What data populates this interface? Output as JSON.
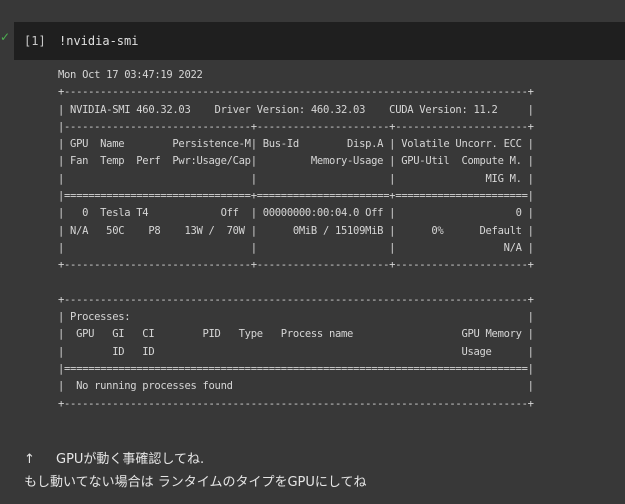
{
  "cell": {
    "execution_count": "[1]",
    "code": "!nvidia-smi",
    "status_icon": "check-icon",
    "status_color": "#4caf50",
    "output_lines": [
      "Mon Oct 17 03:47:19 2022",
      "+-----------------------------------------------------------------------------+",
      "| NVIDIA-SMI 460.32.03    Driver Version: 460.32.03    CUDA Version: 11.2     |",
      "|-------------------------------+----------------------+----------------------+",
      "| GPU  Name        Persistence-M| Bus-Id        Disp.A | Volatile Uncorr. ECC |",
      "| Fan  Temp  Perf  Pwr:Usage/Cap|         Memory-Usage | GPU-Util  Compute M. |",
      "|                               |                      |               MIG M. |",
      "|===============================+======================+======================|",
      "|   0  Tesla T4            Off  | 00000000:00:04.0 Off |                    0 |",
      "| N/A   50C    P8    13W /  70W |      0MiB / 15109MiB |      0%      Default |",
      "|                               |                      |                  N/A |",
      "+-------------------------------+----------------------+----------------------+",
      "",
      "+-----------------------------------------------------------------------------+",
      "| Processes:                                                                  |",
      "|  GPU   GI   CI        PID   Type   Process name                  GPU Memory |",
      "|        ID   ID                                                   Usage      |",
      "|=============================================================================|",
      "|  No running processes found                                                 |",
      "+-----------------------------------------------------------------------------+"
    ]
  },
  "markdown": {
    "arrow": "↑",
    "line1": "GPUが動く事確認してね.",
    "line2": "もし動いてない場合は ランタイムのタイプをGPUにしてね"
  }
}
